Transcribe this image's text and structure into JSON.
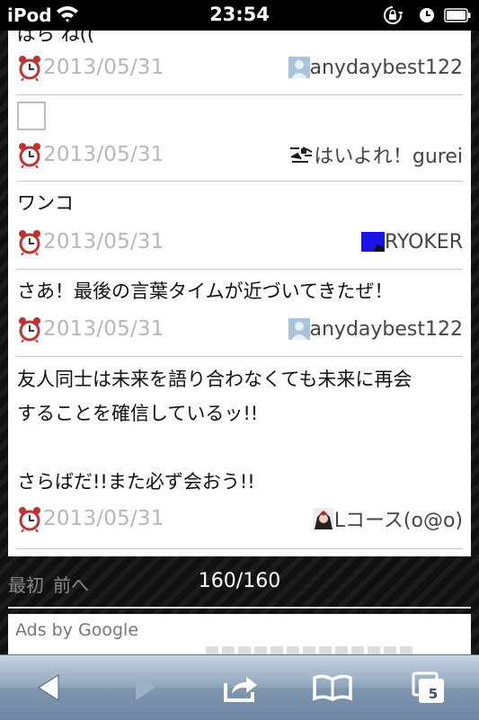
{
  "status_bar": {
    "carrier": "iPod",
    "time": "23:54",
    "icons": [
      "wifi-icon",
      "rotation-lock-icon",
      "alarm-clock-icon",
      "battery-icon"
    ]
  },
  "posts": [
    {
      "text": "ぱら ね((",
      "date": "2013/05/31",
      "user": "anydaybest122",
      "avatar": "default-avatar-icon"
    },
    {
      "text": "",
      "has_image_placeholder": true,
      "date": "2013/05/31",
      "user": "はいよれ！gurei",
      "avatar": "sketch-avatar-icon"
    },
    {
      "text": "ワンコ",
      "date": "2013/05/31",
      "user": "RYOKER",
      "avatar": "blue-avatar-icon"
    },
    {
      "text": "さあ！最後の言葉タイムが近づいてきたぜ！",
      "date": "2013/05/31",
      "user": "anydaybest122",
      "avatar": "default-avatar-icon"
    },
    {
      "text_lines": [
        "友人同士は未来を語り合わなくても未来に再会",
        "することを確信しているッ!!",
        "",
        "さらばだ!!また必ず会おう!!"
      ],
      "date": "2013/05/31",
      "user": "Lコース(o@o)",
      "avatar": "anime-avatar-icon"
    }
  ],
  "pager": {
    "first": "最初",
    "prev": "前へ",
    "count": "160/160"
  },
  "ads": {
    "label": "Ads by Google"
  },
  "toolbar": {
    "buttons": [
      "back-icon",
      "forward-icon",
      "share-icon",
      "bookmarks-icon",
      "tabs-icon"
    ],
    "tab_count": "5"
  },
  "colors": {
    "date": "#b7b7b7",
    "toolbar": "#8ea4bd",
    "card": "#ffffff"
  }
}
